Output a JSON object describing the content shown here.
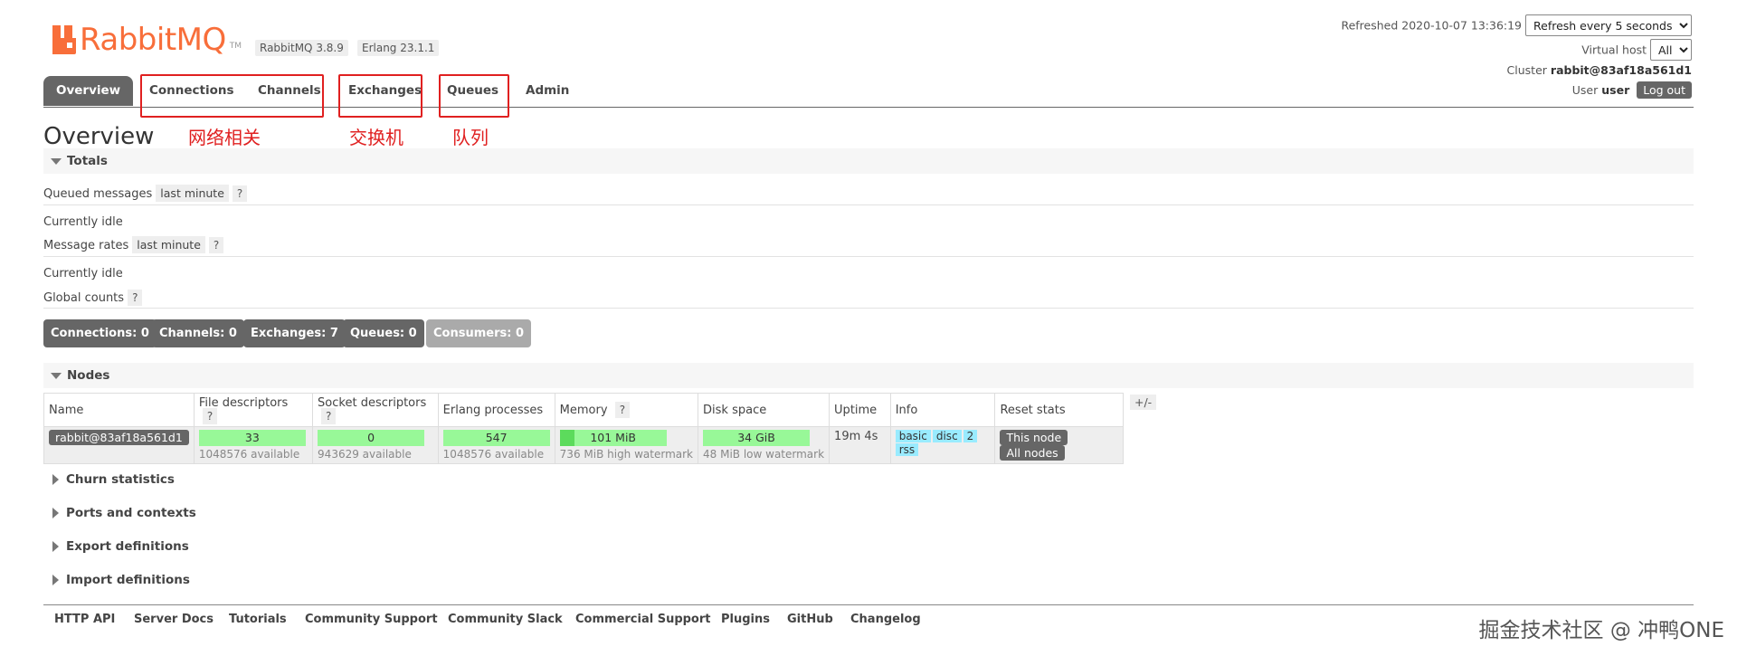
{
  "header": {
    "logo_text": "RabbitMQ",
    "logo_tm": "TM",
    "version_rabbit": "RabbitMQ 3.8.9",
    "version_erlang": "Erlang 23.1.1",
    "refreshed": "Refreshed 2020-10-07 13:36:19",
    "refresh_select": "Refresh every 5 seconds",
    "virtual_host_label": "Virtual host",
    "virtual_host_value": "All",
    "cluster_label": "Cluster",
    "cluster_value": "rabbit@83af18a561d1",
    "user_label": "User",
    "user_value": "user",
    "logout_label": "Log out"
  },
  "tabs": [
    {
      "label": "Overview",
      "active": true
    },
    {
      "label": "Connections"
    },
    {
      "label": "Channels"
    },
    {
      "label": "Exchanges"
    },
    {
      "label": "Queues"
    },
    {
      "label": "Admin"
    }
  ],
  "annotations": {
    "network": "网络相关",
    "exchange": "交换机",
    "queue": "队列",
    "annotation_color": "#e02020"
  },
  "page_title": "Overview",
  "totals": {
    "title": "Totals",
    "queued_messages": "Queued messages",
    "last_minute": "last minute",
    "help": "?",
    "currently_idle": "Currently idle",
    "message_rates": "Message rates",
    "global_counts": "Global counts",
    "counts": [
      {
        "label": "Connections: 0"
      },
      {
        "label": "Channels: 0"
      },
      {
        "label": "Exchanges: 7"
      },
      {
        "label": "Queues: 0"
      },
      {
        "label": "Consumers: 0"
      }
    ]
  },
  "nodes": {
    "title": "Nodes",
    "plus_minus": "+/-",
    "columns": [
      "Name",
      "File descriptors",
      "Socket descriptors",
      "Erlang processes",
      "Memory",
      "Disk space",
      "Uptime",
      "Info",
      "Reset stats"
    ],
    "row": {
      "name": "rabbit@83af18a561d1",
      "file_descriptors": "33",
      "file_descriptors_sub": "1048576 available",
      "socket_descriptors": "0",
      "socket_descriptors_sub": "943629 available",
      "erlang_processes": "547",
      "erlang_processes_sub": "1048576 available",
      "memory": "101 MiB",
      "memory_sub": "736 MiB high watermark",
      "memory_fraction": 0.14,
      "disk_space": "34 GiB",
      "disk_space_sub": "48 MiB low watermark",
      "uptime": "19m 4s",
      "info": [
        "basic",
        "disc",
        "2",
        "rss"
      ],
      "reset_this": "This node",
      "reset_all": "All nodes"
    }
  },
  "sections": [
    "Churn statistics",
    "Ports and contexts",
    "Export definitions",
    "Import definitions"
  ],
  "footer": [
    "HTTP API",
    "Server Docs",
    "Tutorials",
    "Community Support",
    "Community Slack",
    "Commercial Support",
    "Plugins",
    "GitHub",
    "Changelog"
  ],
  "watermark": "掘金技术社区 @ 冲鸭ONE",
  "colors": {
    "brand": "#f86e3a",
    "tab_active": "#666666",
    "bar_green": "#98f898",
    "info_tag": "#99ebff"
  }
}
